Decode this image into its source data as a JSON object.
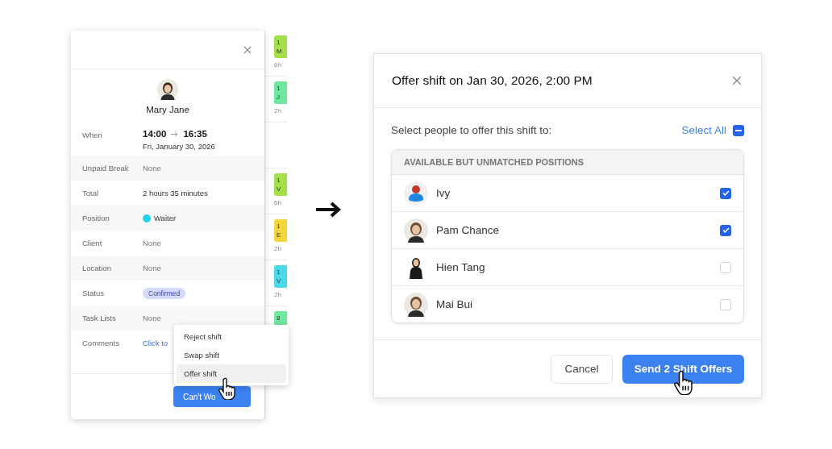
{
  "shift_panel": {
    "employee": "Mary Jane",
    "when": {
      "label": "When",
      "start": "14:00",
      "end": "16:35",
      "date": "Fri, January 30, 2026"
    },
    "details": [
      {
        "label": "Unpaid Break",
        "value": "None",
        "kind": "muted"
      },
      {
        "label": "Total",
        "value": "2 hours 35 minutes",
        "kind": "text"
      },
      {
        "label": "Position",
        "value": "Waiter",
        "kind": "dot",
        "color": "#22d3ee"
      },
      {
        "label": "Client",
        "value": "None",
        "kind": "muted"
      },
      {
        "label": "Location",
        "value": "None",
        "kind": "muted"
      },
      {
        "label": "Status",
        "value": "Confirmed",
        "kind": "badge"
      },
      {
        "label": "Task Lists",
        "value": "None",
        "kind": "muted"
      },
      {
        "label": "Comments",
        "value": "Click to",
        "kind": "link"
      }
    ],
    "button": "Can't Wo",
    "menu": [
      {
        "label": "Reject shift",
        "selected": false
      },
      {
        "label": "Swap shift",
        "selected": false
      },
      {
        "label": "Offer shift",
        "selected": true
      }
    ]
  },
  "calendar_strip": [
    {
      "line_1": "1",
      "line_2": "M",
      "hours": "6h",
      "color": "#a3e04a"
    },
    {
      "line_1": "1",
      "line_2": "J",
      "hours": "2h",
      "color": "#6ee7a0"
    },
    {
      "line_1": "1",
      "line_2": "V",
      "hours": "6h",
      "color": "#a3e04a"
    },
    {
      "line_1": "1",
      "line_2": "E",
      "hours": "2h",
      "color": "#f5d63d"
    },
    {
      "line_1": "1",
      "line_2": "V",
      "hours": "2h",
      "color": "#4dd9ec"
    },
    {
      "line_1": "8",
      "color": "#6ee7a0"
    }
  ],
  "offer_dialog": {
    "title": "Offer shift on Jan 30, 2026, 2:00 PM",
    "prompt": "Select people to offer this shift to:",
    "select_all": {
      "label": "Select All",
      "indeterminate": true
    },
    "section": "AVAILABLE BUT UNMATCHED POSITIONS",
    "people": [
      {
        "name": "Ivy",
        "kind": "icon",
        "checked": true
      },
      {
        "name": "Pam Chance",
        "kind": "photo",
        "checked": true
      },
      {
        "name": "Hien Tang",
        "kind": "figure",
        "checked": false
      },
      {
        "name": "Mai Bui",
        "kind": "photo",
        "checked": false
      }
    ],
    "cancel": "Cancel",
    "send": "Send 2 Shift Offers"
  }
}
